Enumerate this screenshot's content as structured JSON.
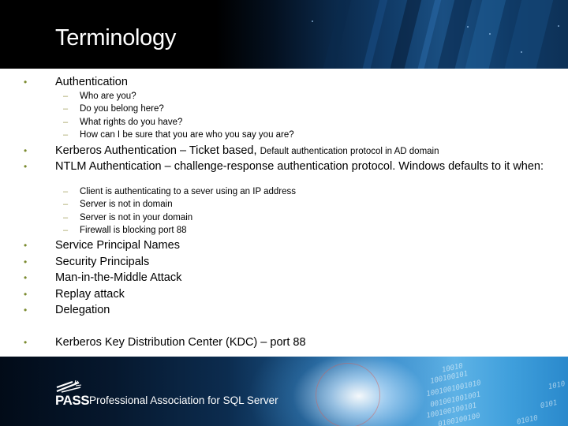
{
  "slide": {
    "title": "Terminology"
  },
  "colors": {
    "bullet": "#7a8a2e",
    "dash": "#a29e5a",
    "text": "#000000",
    "title": "#ffffff"
  },
  "content": {
    "bullet_glyph": "•",
    "dash_glyph": "–",
    "items": [
      {
        "text": "Authentication",
        "sub": [
          "Who are you?",
          "Do you belong here?",
          "What rights do you have?",
          "How can I be sure that you are who you say you are?"
        ]
      },
      {
        "text": "Kerberos Authentication – Ticket based, ",
        "text_small": "Default authentication protocol in AD domain"
      },
      {
        "text": "NTLM Authentication – challenge-response authentication protocol.  Windows defaults to it when:",
        "sub": [
          "Client is authenticating to a sever using an IP address",
          "Server is not in domain",
          "Server is not in your domain",
          "Firewall is blocking port 88"
        ]
      },
      {
        "text": "Service Principal Names"
      },
      {
        "text": "Security Principals"
      },
      {
        "text": "Man-in-the-Middle Attack"
      },
      {
        "text": "Replay attack"
      },
      {
        "text": "Delegation"
      },
      {
        "text": "Kerberos Key Distribution Center (KDC) – port 88"
      }
    ]
  },
  "footer": {
    "logo_text": "PASS",
    "tagline": "Professional Association for SQL Server",
    "binary_lines": [
      "10010",
      "100100101",
      "1001001001010",
      "001001001001",
      "100100100101",
      "0100100100",
      "1010",
      "0101",
      "01010"
    ]
  }
}
